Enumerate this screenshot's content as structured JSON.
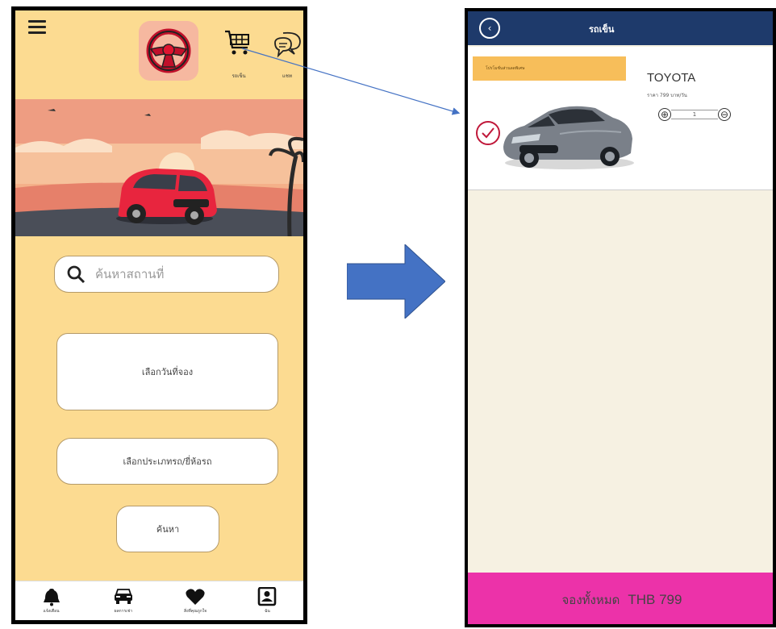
{
  "left_screen": {
    "menu_icon": "hamburger-icon",
    "logo_icon": "steering-wheel-icon",
    "cart": {
      "icon": "cart-icon",
      "label": "รถเข็น"
    },
    "chat": {
      "icon": "chat-icon",
      "label": "แชท"
    },
    "search": {
      "placeholder": "ค้นหาสถานที่",
      "icon": "search-icon"
    },
    "select_date_button": "เลือกวันที่จอง",
    "select_type_button": "เลือกประเภทรถ/ยี่ห้อรถ",
    "search_button": "ค้นหา",
    "bottom_nav": [
      {
        "icon": "bell-icon",
        "label": "แจ้งเตือน"
      },
      {
        "icon": "car-icon",
        "label": "ผลการเช่า"
      },
      {
        "icon": "heart-icon",
        "label": "สิ่งที่คุณถูกใจ"
      },
      {
        "icon": "user-icon",
        "label": "ฉัน"
      }
    ]
  },
  "right_screen": {
    "header": {
      "back_icon": "back-circle-icon",
      "title": "รถเข็น"
    },
    "cart_item": {
      "promo": "โปรโมชั่นส่วนลดพิเศษ",
      "check_icon": "check-circle-icon",
      "name": "TOYOTA",
      "price_text": "ราคา 799 บาท/วัน",
      "qty_minus": "⊕",
      "qty_value": "1",
      "qty_plus": "⊖"
    },
    "footer": {
      "label": "จองทั้งหมด",
      "amount": "THB 799"
    }
  },
  "colors": {
    "left_bg": "#fcdb91",
    "header_navy": "#1e3a6b",
    "footer_pink": "#ec32a9",
    "promo_orange": "#f7be5a",
    "arrow_blue": "#4472c4"
  }
}
